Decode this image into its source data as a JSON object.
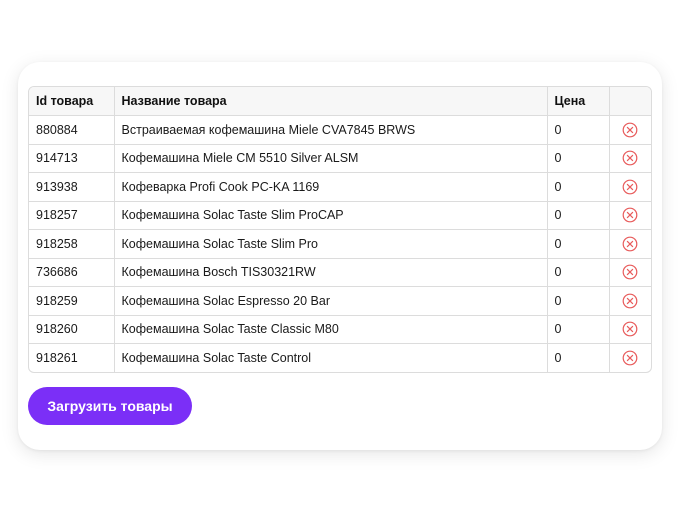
{
  "table": {
    "headers": {
      "id": "Id товара",
      "name": "Название товара",
      "price": "Цена",
      "actions": ""
    },
    "rows": [
      {
        "id": "880884",
        "name": "Встраиваемая кофемашина Miele CVA7845 BRWS",
        "price": "0",
        "delete_icon": "circle-x-icon"
      },
      {
        "id": "914713",
        "name": "Кофемашина Miele CM 5510 Silver ALSM",
        "price": "0",
        "delete_icon": "circle-x-icon"
      },
      {
        "id": "913938",
        "name": "Кофеварка Profi Cook PC-KA 1169",
        "price": "0",
        "delete_icon": "circle-x-icon"
      },
      {
        "id": "918257",
        "name": "Кофемашина Solac Taste Slim ProCAP",
        "price": "0",
        "delete_icon": "circle-x-icon"
      },
      {
        "id": "918258",
        "name": "Кофемашина Solac Taste Slim Pro",
        "price": "0",
        "delete_icon": "circle-x-icon"
      },
      {
        "id": "736686",
        "name": "Кофемашина Bosch TIS30321RW",
        "price": "0",
        "delete_icon": "circle-x-icon"
      },
      {
        "id": "918259",
        "name": "Кофемашина Solac Espresso 20 Bar",
        "price": "0",
        "delete_icon": "circle-x-icon"
      },
      {
        "id": "918260",
        "name": "Кофемашина Solac Taste Classic M80",
        "price": "0",
        "delete_icon": "circle-x-icon"
      },
      {
        "id": "918261",
        "name": "Кофемашина Solac Taste Control",
        "price": "0",
        "delete_icon": "circle-x-icon"
      }
    ]
  },
  "load_button": {
    "label": "Загрузить товары"
  },
  "colors": {
    "accent": "#7b2ff7",
    "delete_icon": "#e85b5b",
    "border": "#dcdcdc",
    "header_bg": "#f7f7f7"
  }
}
